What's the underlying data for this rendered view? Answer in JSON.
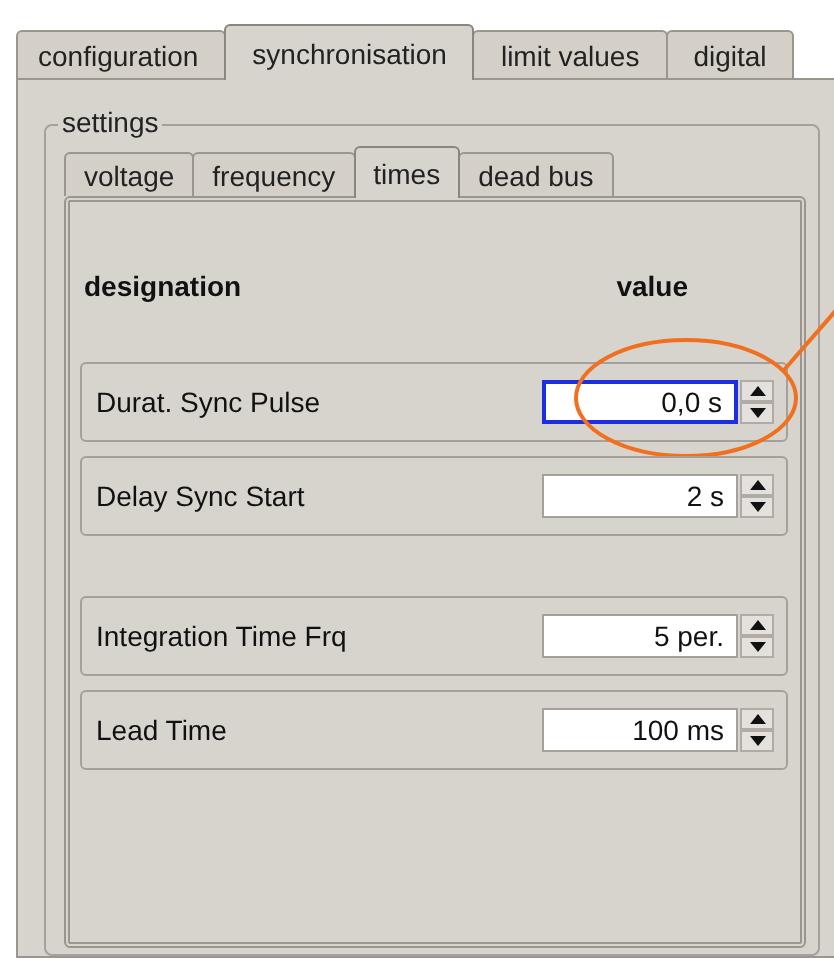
{
  "tabs": [
    {
      "label": "configuration",
      "selected": false
    },
    {
      "label": "synchronisation",
      "selected": true
    },
    {
      "label": "limit values",
      "selected": false
    },
    {
      "label": "digital",
      "selected": false
    }
  ],
  "settings": {
    "title": "settings",
    "tabs": [
      {
        "label": "voltage",
        "selected": false
      },
      {
        "label": "frequency",
        "selected": false
      },
      {
        "label": "times",
        "selected": true
      },
      {
        "label": "dead bus",
        "selected": false
      }
    ],
    "header": {
      "designation": "designation",
      "value": "value"
    },
    "groups": [
      [
        {
          "designation": "Durat. Sync Pulse",
          "value": "0,0 s",
          "focused": true,
          "highlighted": true
        },
        {
          "designation": "Delay Sync Start",
          "value": "2 s",
          "focused": false,
          "highlighted": false
        }
      ],
      [
        {
          "designation": "Integration Time Frq",
          "value": "5 per.",
          "focused": false,
          "highlighted": false
        },
        {
          "designation": "Lead Time",
          "value": "100 ms",
          "focused": false,
          "highlighted": false
        }
      ]
    ]
  }
}
